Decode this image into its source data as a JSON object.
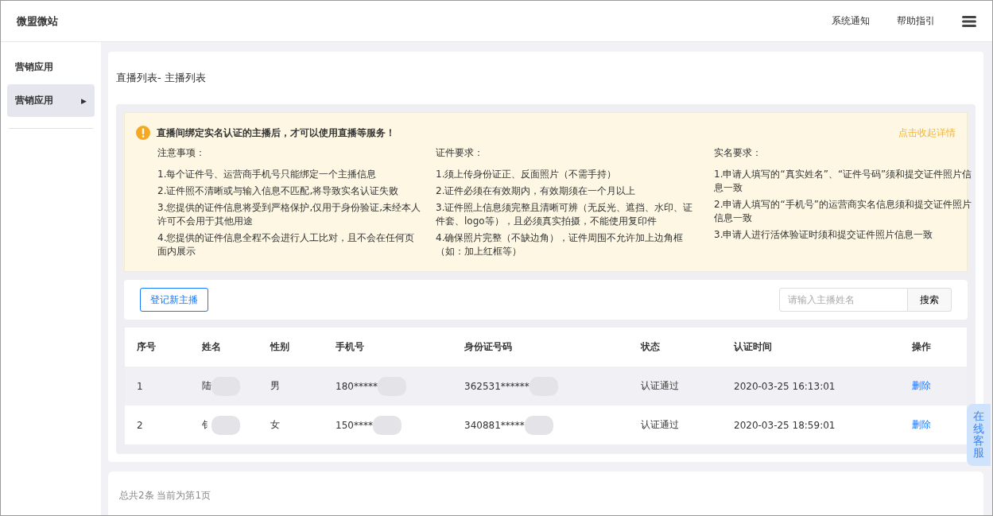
{
  "header": {
    "logo": "微盟微站",
    "links": [
      "系统通知",
      "帮助指引"
    ]
  },
  "sidebar": {
    "title": "营销应用",
    "items": [
      {
        "label": "营销应用",
        "selected": true,
        "arrow": "▶"
      }
    ]
  },
  "page_title": {
    "prefix": "直播列表-",
    "current": "主播列表"
  },
  "notice": {
    "headline": "直播间绑定实名认证的主播后，才可以使用直播等服务！",
    "toggle": "点击收起详情",
    "columns": [
      {
        "title": "注意事项：",
        "items": [
          "1.每个证件号、运营商手机号只能绑定一个主播信息",
          "2.证件照不清晰或与输入信息不匹配,将导致实名认证失败",
          "3.您提供的证件信息将受到严格保护,仅用于身份验证,未经本人许可不会用于其他用途",
          "4.您提供的证件信息全程不会进行人工比对，且不会在任何页面内展示"
        ]
      },
      {
        "title": "证件要求：",
        "items": [
          "1.须上传身份证正、反面照片（不需手持）",
          "2.证件必须在有效期内，有效期须在一个月以上",
          "3.证件照上信息须完整且清晰可辨（无反光、遮挡、水印、证件套、logo等），且必须真实拍摄，不能使用复印件",
          "4.确保照片完整（不缺边角），证件周围不允许加上边角框（如：加上红框等）"
        ]
      },
      {
        "title": "实名要求：",
        "items": [
          "1.申请人填写的“真实姓名”、“证件号码”须和提交证件照片信息一致",
          "2.申请人填写的“手机号”的运营商实名信息须和提交证件照片信息一致",
          "3.申请人进行活体验证时须和提交证件照片信息一致"
        ]
      }
    ]
  },
  "toolbar": {
    "add_button": "登记新主播",
    "search": {
      "placeholder": "请输入主播姓名",
      "button": "搜索"
    }
  },
  "table": {
    "columns": [
      "序号",
      "姓名",
      "性别",
      "手机号",
      "身份证号码",
      "状态",
      "认证时间",
      "操作"
    ],
    "rows": [
      {
        "index": "1",
        "name": "陆",
        "gender": "男",
        "phone": "180*****",
        "id_number": "362531******",
        "status": "认证通过",
        "time": "2020-03-25 16:13:01",
        "action": "删除",
        "highlighted": true
      },
      {
        "index": "2",
        "name": "钅",
        "gender": "女",
        "phone": "150****",
        "id_number": "340881*****",
        "status": "认证通过",
        "time": "2020-03-25 18:59:01",
        "action": "删除",
        "highlighted": false
      }
    ]
  },
  "footer": {
    "summary": "总共2条 当前为第1页"
  },
  "service_tab": {
    "label": "在线客服"
  }
}
